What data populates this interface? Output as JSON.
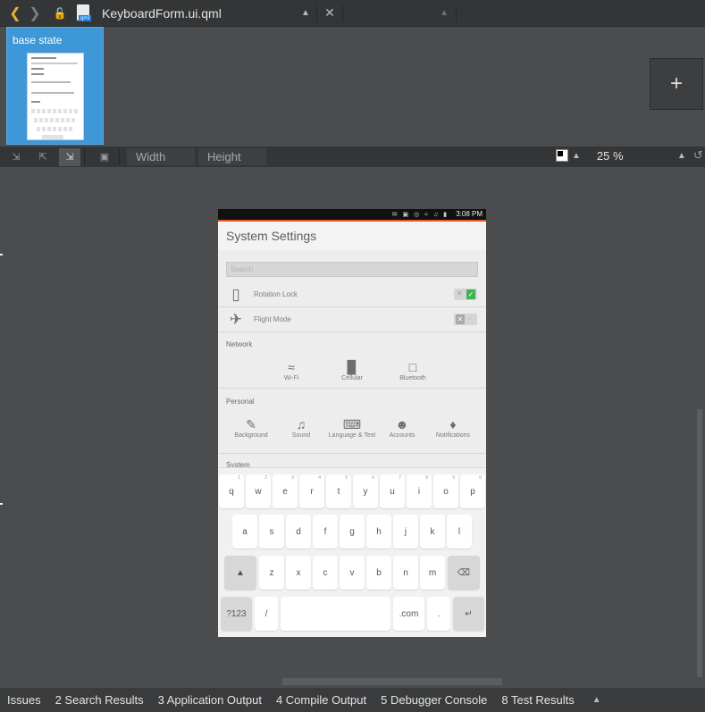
{
  "toolbar": {
    "file_title": "KeyboardForm.ui.qml",
    "qml_tag": "qml"
  },
  "states": {
    "base_state_label": "base state",
    "add_label": "+"
  },
  "form_toolbar": {
    "width_placeholder": "Width",
    "height_placeholder": "Height",
    "zoom": "25 %"
  },
  "phone": {
    "status_time": "3:08 PM",
    "app_title": "System Settings",
    "search_placeholder": "Search",
    "rows": [
      {
        "label": "Rotation Lock",
        "on": true
      },
      {
        "label": "Flight Mode",
        "on": false
      }
    ],
    "network_title": "Network",
    "network_items": [
      "Wi-Fi",
      "Cellular",
      "Bluetooth"
    ],
    "personal_title": "Personal",
    "personal_items": [
      "Background",
      "Sound",
      "Language & Text",
      "Accounts",
      "Notifications"
    ],
    "system_title": "System"
  },
  "keyboard": {
    "row1": [
      "q",
      "w",
      "e",
      "r",
      "t",
      "y",
      "u",
      "i",
      "o",
      "p"
    ],
    "row1_hints": [
      "1",
      "2",
      "3",
      "4",
      "5",
      "6",
      "7",
      "8",
      "9",
      "0"
    ],
    "row2": [
      "a",
      "s",
      "d",
      "f",
      "g",
      "h",
      "j",
      "k",
      "l"
    ],
    "row3": [
      "z",
      "x",
      "c",
      "v",
      "b",
      "n",
      "m"
    ],
    "symbols_key": "?123",
    "slash_key": "/",
    "dotcom_key": ".com",
    "dot_key": "."
  },
  "output_tabs": [
    "Issues",
    "2  Search Results",
    "3  Application Output",
    "4  Compile Output",
    "5  Debugger Console",
    "8  Test Results"
  ]
}
